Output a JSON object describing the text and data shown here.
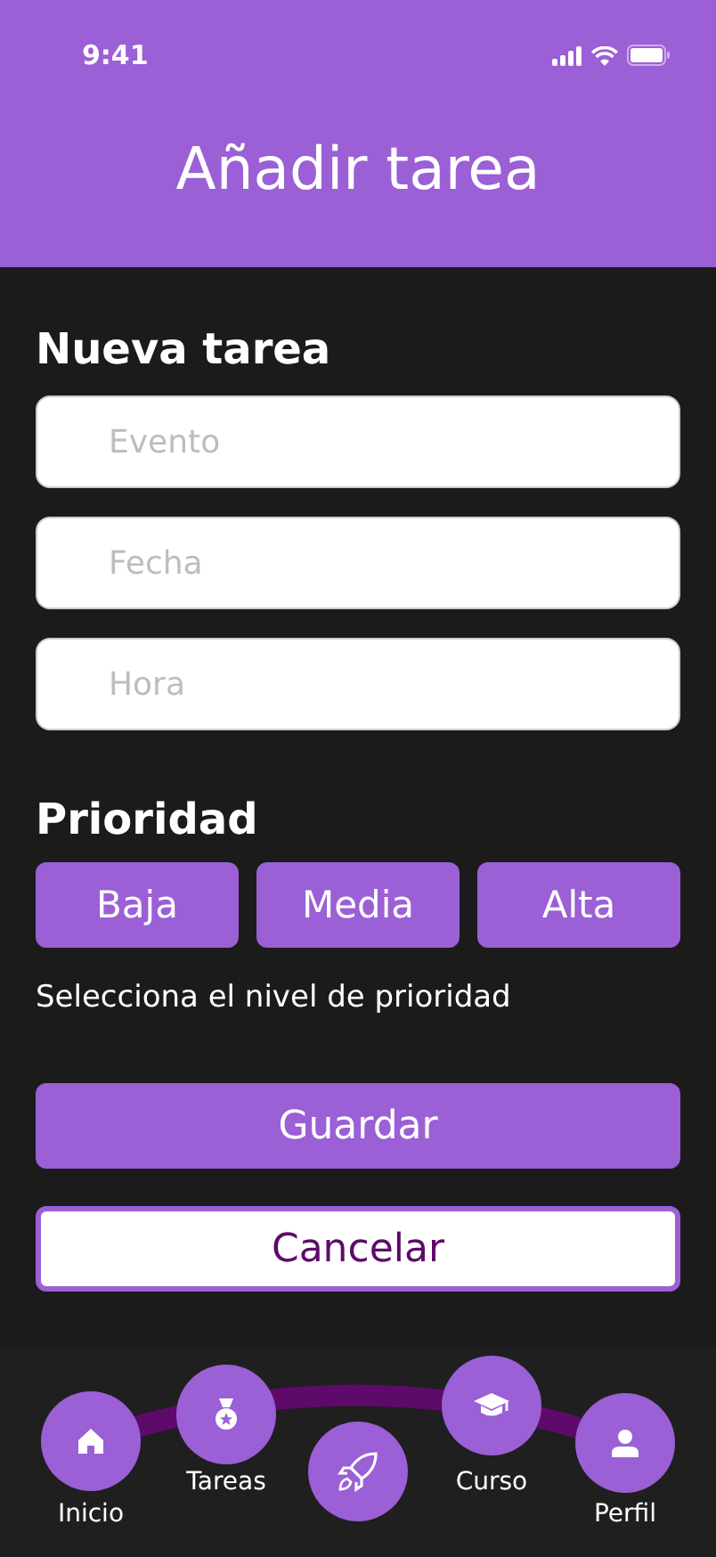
{
  "status_bar": {
    "time": "9:41"
  },
  "header": {
    "title": "Añadir tarea"
  },
  "form": {
    "title": "Nueva tarea",
    "fields": [
      {
        "placeholder": "Evento"
      },
      {
        "placeholder": "Fecha"
      },
      {
        "placeholder": "Hora"
      }
    ]
  },
  "priority": {
    "title": "Prioridad",
    "options": [
      "Baja",
      "Media",
      "Alta"
    ],
    "hint": "Selecciona el nivel de prioridad"
  },
  "buttons": [
    {
      "label": "Guardar",
      "kind": "primary"
    },
    {
      "label": "Cancelar",
      "kind": "secondary"
    }
  ],
  "bottom_nav": [
    {
      "label": "Inicio"
    },
    {
      "label": "Tareas"
    },
    {
      "label": "Curso"
    },
    {
      "label": "Perfil"
    }
  ]
}
